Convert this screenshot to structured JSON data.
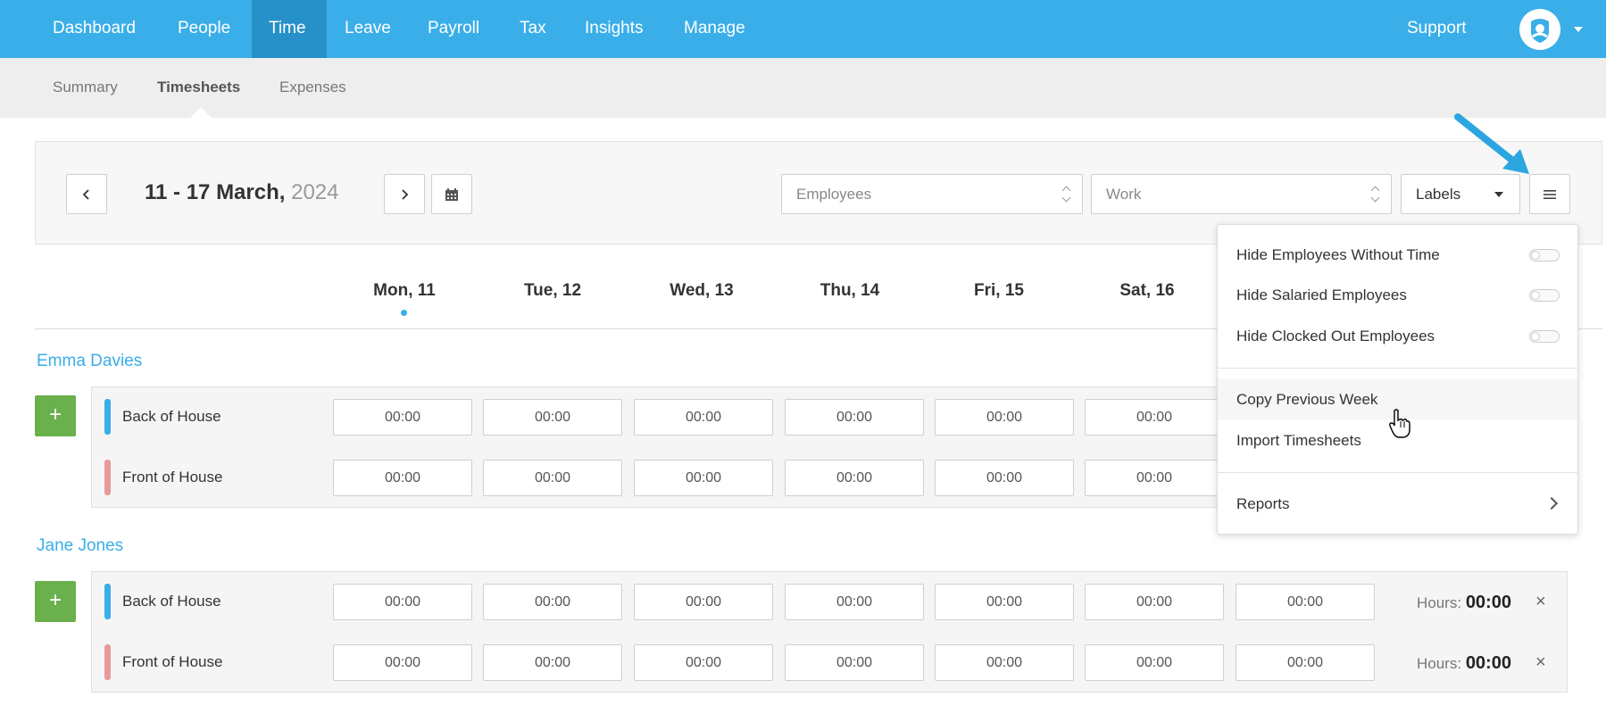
{
  "top_nav": {
    "items": [
      {
        "label": "Dashboard"
      },
      {
        "label": "People"
      },
      {
        "label": "Time"
      },
      {
        "label": "Leave"
      },
      {
        "label": "Payroll"
      },
      {
        "label": "Tax"
      },
      {
        "label": "Insights"
      },
      {
        "label": "Manage"
      }
    ],
    "active": "Time",
    "support_label": "Support",
    "avatar_icon": "user-avatar-icon",
    "colors": {
      "nav_bg": "#3aaee8",
      "nav_active": "#2691c8"
    }
  },
  "sub_nav": {
    "items": [
      {
        "label": "Summary"
      },
      {
        "label": "Timesheets"
      },
      {
        "label": "Expenses"
      }
    ],
    "active": "Timesheets"
  },
  "toolbar": {
    "date_range": "11 - 17 March,",
    "year": "2024",
    "employees_placeholder": "Employees",
    "work_placeholder": "Work",
    "labels_value": "Labels",
    "prev_icon": "chevron-left-icon",
    "next_icon": "chevron-right-icon",
    "calendar_icon": "calendar-icon",
    "menu_icon": "hamburger-menu-icon"
  },
  "days": [
    "Mon, 11",
    "Tue, 12",
    "Wed, 13",
    "Thu, 14",
    "Fri, 15",
    "Sat, 16"
  ],
  "today_day": "Mon, 11",
  "employees": [
    {
      "name": "Emma Davies",
      "rows": [
        {
          "label": "Back of House",
          "color": "#3aaee8",
          "times": [
            "00:00",
            "00:00",
            "00:00",
            "00:00",
            "00:00",
            "00:00"
          ]
        },
        {
          "label": "Front of House",
          "color": "#e89a9a",
          "times": [
            "00:00",
            "00:00",
            "00:00",
            "00:00",
            "00:00",
            "00:00"
          ]
        }
      ]
    },
    {
      "name": "Jane Jones",
      "rows": [
        {
          "label": "Back of House",
          "color": "#3aaee8",
          "times": [
            "00:00",
            "00:00",
            "00:00",
            "00:00",
            "00:00",
            "00:00",
            "00:00"
          ],
          "hours_label": "Hours:",
          "hours_value": "00:00"
        },
        {
          "label": "Front of House",
          "color": "#e89a9a",
          "times": [
            "00:00",
            "00:00",
            "00:00",
            "00:00",
            "00:00",
            "00:00",
            "00:00"
          ],
          "hours_label": "Hours:",
          "hours_value": "00:00"
        }
      ]
    }
  ],
  "menu": {
    "toggles": [
      {
        "label": "Hide Employees Without Time",
        "on": false
      },
      {
        "label": "Hide Salaried Employees",
        "on": false
      },
      {
        "label": "Hide Clocked Out Employees",
        "on": false
      }
    ],
    "actions": [
      {
        "label": "Copy Previous Week"
      },
      {
        "label": "Import Timesheets"
      }
    ],
    "reports_label": "Reports"
  },
  "add_label": "+",
  "remove_label": "×"
}
